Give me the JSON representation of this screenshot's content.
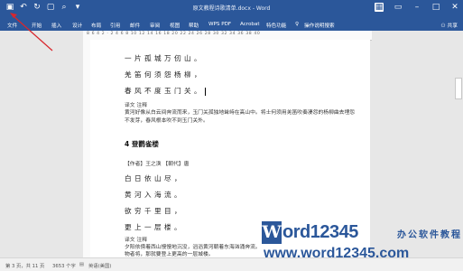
{
  "window": {
    "title": "原文教程诗歌清单.docx - Word",
    "qat_icons": [
      "save-icon",
      "undo-icon",
      "redo-icon",
      "new-document-icon",
      "print-preview-icon",
      "customize-chevron-icon"
    ],
    "controls_icons": [
      "account-icon",
      "ribbon-display-icon",
      "minimize-icon",
      "restore-icon",
      "close-icon"
    ]
  },
  "menu": {
    "items": [
      "文件",
      "开始",
      "插入",
      "设计",
      "布局",
      "引用",
      "邮件",
      "审阅",
      "视图",
      "帮助",
      "WPS PDF",
      "Acrobat",
      "特色功能",
      "操作说明搜索"
    ],
    "share": "共享"
  },
  "ruler": {
    "numbers": "8 6 4 2 · 2 4 6 8 10 12 14 16 18 20 22 24 26 28 30 32 34 36 38 40"
  },
  "document": {
    "lines1": [
      "一片孤城万仞山。",
      "羌笛何须怨杨柳，",
      "春风不度玉门关。"
    ],
    "note1_label": "译文 注释",
    "note1_text1": "黄河好像从白云间奔流而来，玉门关孤独地耸峙在高山中。将士何须用羌笛吹奏凄怨的杨柳曲去埋怨",
    "note1_text2": "不发芽，春风根本吹不到玉门关外。",
    "heading": "4 登鹳雀楼",
    "author_line": "【作者】王之涣 【朝代】唐",
    "lines2": [
      "白日依山尽，",
      "黄河入海流。",
      "欲穷千里目，",
      "更上一层楼。"
    ],
    "note2_label": "译文 注释",
    "note2_text1": "夕阳依傍着西山慢慢地沉没，滔滔黄河朝着东海汹涌奔流。",
    "note2_text2": "物者将，那就要登上更高的一层城楼。"
  },
  "status": {
    "page": "第 3 页，共 11 页",
    "words": "3653 个字",
    "lang": "英语(美国)"
  },
  "watermark": {
    "letter": "W",
    "word": "ord12345",
    "cn": "办公软件教程",
    "url": "www.word12345.com"
  },
  "colors": {
    "accent": "#2b579a",
    "annotation": "#d9262c"
  }
}
